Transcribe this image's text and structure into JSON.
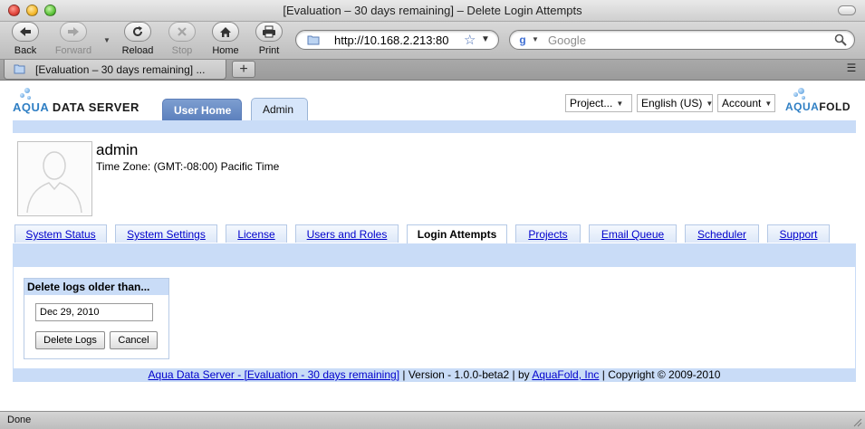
{
  "window": {
    "title": "[Evaluation – 30 days remaining] – Delete Login Attempts"
  },
  "toolbar": {
    "back_label": "Back",
    "forward_label": "Forward",
    "reload_label": "Reload",
    "stop_label": "Stop",
    "home_label": "Home",
    "print_label": "Print",
    "url": "http://10.168.2.213:80",
    "search_placeholder": "Google"
  },
  "tabs": {
    "active_title": "[Evaluation – 30 days remaining] ...",
    "new_tab_label": "+"
  },
  "header": {
    "logo_left_aqua": "AQUA",
    "logo_left_rest": " DATA SERVER",
    "logo_right_aqua": "AQUA",
    "logo_right_rest": "FOLD",
    "nav_tabs": {
      "user_home": "User Home",
      "admin": "Admin"
    },
    "selects": {
      "project": "Project...",
      "language": "English (US)",
      "account": "Account"
    }
  },
  "user": {
    "name": "admin",
    "timezone": "Time Zone: (GMT:-08:00) Pacific Time"
  },
  "admin_tabs": [
    {
      "label": "System Status",
      "active": false
    },
    {
      "label": "System Settings",
      "active": false
    },
    {
      "label": "License",
      "active": false
    },
    {
      "label": "Users and Roles",
      "active": false
    },
    {
      "label": "Login Attempts",
      "active": true
    },
    {
      "label": "Projects",
      "active": false
    },
    {
      "label": "Email Queue",
      "active": false
    },
    {
      "label": "Scheduler",
      "active": false
    },
    {
      "label": "Support",
      "active": false
    }
  ],
  "delete_form": {
    "title": "Delete logs older than...",
    "date_value": "Dec 29, 2010",
    "delete_label": "Delete Logs",
    "cancel_label": "Cancel"
  },
  "footer": {
    "product_link": "Aqua Data Server - [Evaluation - 30 days remaining]",
    "version_text": " | Version - 1.0.0-beta2 | by ",
    "company_link": "AquaFold, Inc",
    "copyright_text": " | Copyright © 2009-2010"
  },
  "status": {
    "text": "Done"
  },
  "colors": {
    "band_blue": "#c9dcf7",
    "link_blue": "#0000cc",
    "user_home_tab": "#6a8dc6",
    "aqua_logo": "#2f7fc4"
  }
}
